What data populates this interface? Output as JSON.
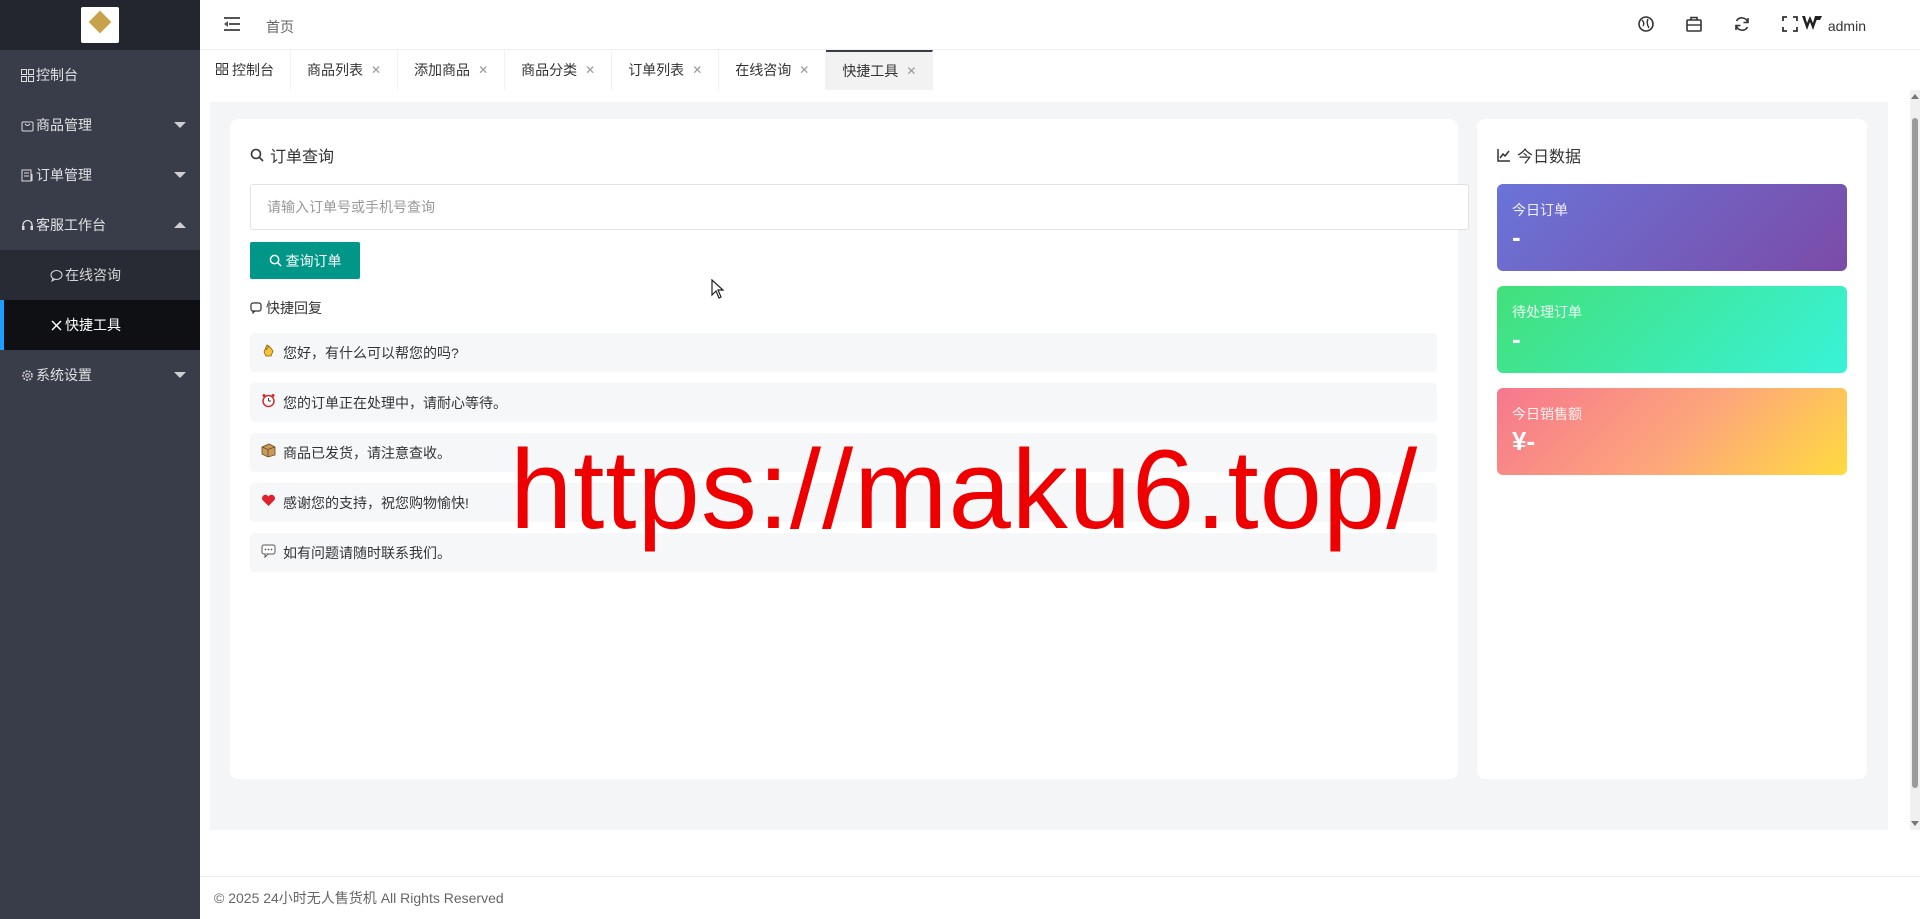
{
  "sidebar": {
    "items": [
      {
        "label": "控制台"
      },
      {
        "label": "商品管理"
      },
      {
        "label": "订单管理"
      },
      {
        "label": "客服工作台"
      },
      {
        "label": "系统设置"
      }
    ],
    "sub_items": [
      {
        "label": "在线咨询"
      },
      {
        "label": "快捷工具"
      }
    ]
  },
  "header": {
    "breadcrumb": "首页",
    "user": "admin"
  },
  "tabs": [
    {
      "label": "控制台"
    },
    {
      "label": "商品列表"
    },
    {
      "label": "添加商品"
    },
    {
      "label": "商品分类"
    },
    {
      "label": "订单列表"
    },
    {
      "label": "在线咨询"
    },
    {
      "label": "快捷工具"
    }
  ],
  "order_query": {
    "title": "订单查询",
    "placeholder": "请输入订单号或手机号查询",
    "button": "查询订单"
  },
  "quick_reply": {
    "title": "快捷回复",
    "items": [
      {
        "icon": "clapping-hands",
        "text": "您好，有什么可以帮您的吗?"
      },
      {
        "icon": "alarm-clock",
        "text": "您的订单正在处理中，请耐心等待。"
      },
      {
        "icon": "package",
        "text": "商品已发货，请注意查收。"
      },
      {
        "icon": "heart",
        "text": "感谢您的支持，祝您购物愉快!"
      },
      {
        "icon": "speech-bubble",
        "text": "如有问题请随时联系我们。"
      }
    ]
  },
  "today": {
    "title": "今日数据",
    "stats": [
      {
        "label": "今日订单",
        "value": "-"
      },
      {
        "label": "待处理订单",
        "value": "-"
      },
      {
        "label": "今日销售额",
        "value": "¥-"
      }
    ]
  },
  "watermark": "https://maku6.top/",
  "footer": "© 2025 24小时无人售货机 All Rights Reserved",
  "colors": {
    "sidebar_bg": "#393d49",
    "accent_button": "#009688",
    "watermark": "#ee0000"
  }
}
